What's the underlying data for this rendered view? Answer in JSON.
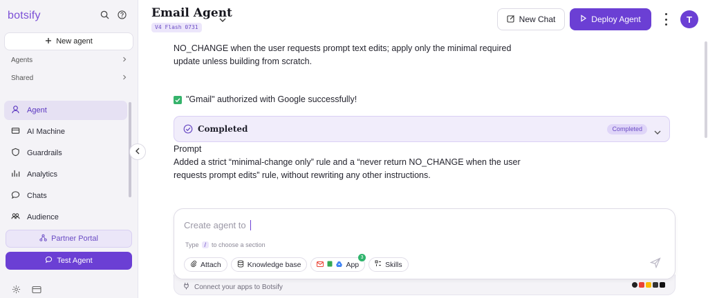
{
  "app": {
    "brand": "botsify"
  },
  "sidebar": {
    "new_agent_label": "New agent",
    "sections": [
      {
        "label": "Agents"
      },
      {
        "label": "Shared"
      }
    ],
    "items": [
      {
        "label": "Agent",
        "icon": "agent-icon",
        "active": true
      },
      {
        "label": "AI Machine",
        "icon": "machine-icon"
      },
      {
        "label": "Guardrails",
        "icon": "shield-icon"
      },
      {
        "label": "Analytics",
        "icon": "analytics-icon"
      },
      {
        "label": "Chats",
        "icon": "chat-icon"
      },
      {
        "label": "Audience",
        "icon": "audience-icon"
      }
    ],
    "partner_portal_label": "Partner Portal",
    "test_agent_label": "Test Agent"
  },
  "header": {
    "title": "Email Agent",
    "model_badge": "V4 Flash 0731",
    "new_chat_label": "New Chat",
    "deploy_label": "Deploy Agent",
    "avatar_initial": "T"
  },
  "chat": {
    "line1": "NO_CHANGE when the user requests prompt text edits; apply only the minimal required",
    "line2": "update unless building from scratch.",
    "auth_message": "\"Gmail\" authorized with Google successfully!",
    "completed_title": "Completed",
    "completed_badge": "Completed",
    "result_heading": "Prompt",
    "result_line1": "Added a strict “minimal-change only” rule and a “never return NO_CHANGE when the user",
    "result_line2": "requests prompt edits” rule, without rewriting any other instructions."
  },
  "composer": {
    "placeholder": "Create agent to",
    "hint_prefix": "Type",
    "hint_key": "/",
    "hint_suffix": "to choose a section",
    "chips": {
      "attach": "Attach",
      "knowledge": "Knowledge base",
      "app": "App",
      "app_count": "3",
      "skills": "Skills"
    },
    "connect_text": "Connect your apps to Botsify"
  },
  "colors": {
    "accent": "#6b3fd4",
    "accent_soft": "#ebe6f8",
    "success": "#35b36b"
  }
}
